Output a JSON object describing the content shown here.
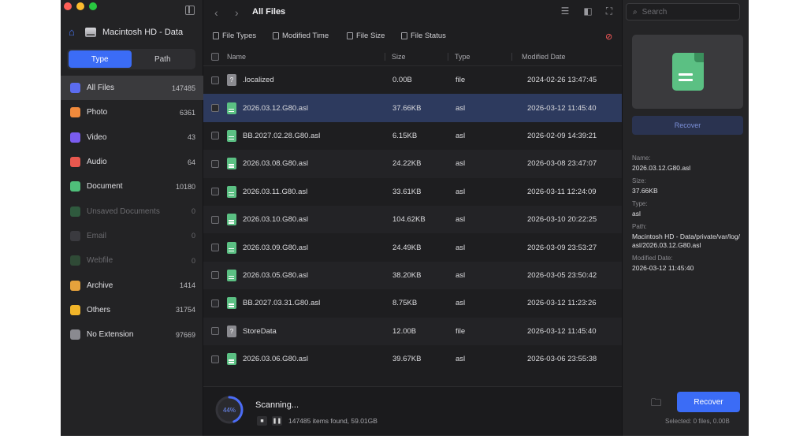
{
  "window": {
    "title": "All Files"
  },
  "sidebar": {
    "drive": "Macintosh HD - Data",
    "view_modes": [
      "Type",
      "Path"
    ],
    "categories": [
      {
        "label": "All Files",
        "count": "147485",
        "color": "#5b6cf0",
        "dim": false,
        "selected": true
      },
      {
        "label": "Photo",
        "count": "6361",
        "color": "#f08a3c",
        "dim": false
      },
      {
        "label": "Video",
        "count": "43",
        "color": "#7a5cf0",
        "dim": false
      },
      {
        "label": "Audio",
        "count": "64",
        "color": "#e8584f",
        "dim": false
      },
      {
        "label": "Document",
        "count": "10180",
        "color": "#4fbf7a",
        "dim": false
      },
      {
        "label": "Unsaved Documents",
        "count": "0",
        "color": "#2f5a3e",
        "dim": true
      },
      {
        "label": "Email",
        "count": "0",
        "color": "#3a3a3f",
        "dim": true
      },
      {
        "label": "Webfile",
        "count": "0",
        "color": "#2f4a36",
        "dim": true
      },
      {
        "label": "Archive",
        "count": "1414",
        "color": "#e6a23c",
        "dim": false
      },
      {
        "label": "Others",
        "count": "31754",
        "color": "#f0b429",
        "dim": false
      },
      {
        "label": "No Extension",
        "count": "97669",
        "color": "#8a8a90",
        "dim": false
      }
    ]
  },
  "filters": [
    "File Types",
    "Modified Time",
    "File Size",
    "File Status"
  ],
  "table": {
    "headers": {
      "name": "Name",
      "size": "Size",
      "type": "Type",
      "date": "Modified Date"
    },
    "rows": [
      {
        "icon": "unknown-file-icon",
        "name": ".localized",
        "size": "0.00B",
        "type": "file",
        "date": "2024-02-26 13:47:45"
      },
      {
        "icon": "document-icon",
        "name": "2026.03.12.G80.asl",
        "size": "37.66KB",
        "type": "asl",
        "date": "2026-03-12 11:45:40",
        "selected": true
      },
      {
        "icon": "document-icon",
        "name": "BB.2027.02.28.G80.asl",
        "size": "6.15KB",
        "type": "asl",
        "date": "2026-02-09 14:39:21"
      },
      {
        "icon": "document-icon",
        "name": "2026.03.08.G80.asl",
        "size": "24.22KB",
        "type": "asl",
        "date": "2026-03-08 23:47:07"
      },
      {
        "icon": "document-icon",
        "name": "2026.03.11.G80.asl",
        "size": "33.61KB",
        "type": "asl",
        "date": "2026-03-11 12:24:09"
      },
      {
        "icon": "document-icon",
        "name": "2026.03.10.G80.asl",
        "size": "104.62KB",
        "type": "asl",
        "date": "2026-03-10 20:22:25"
      },
      {
        "icon": "document-icon",
        "name": "2026.03.09.G80.asl",
        "size": "24.49KB",
        "type": "asl",
        "date": "2026-03-09 23:53:27"
      },
      {
        "icon": "document-icon",
        "name": "2026.03.05.G80.asl",
        "size": "38.20KB",
        "type": "asl",
        "date": "2026-03-05 23:50:42"
      },
      {
        "icon": "document-icon",
        "name": "BB.2027.03.31.G80.asl",
        "size": "8.75KB",
        "type": "asl",
        "date": "2026-03-12 11:23:26"
      },
      {
        "icon": "unknown-file-icon",
        "name": "StoreData",
        "size": "12.00B",
        "type": "file",
        "date": "2026-03-12 11:45:40"
      },
      {
        "icon": "document-icon",
        "name": "2026.03.06.G80.asl",
        "size": "39.67KB",
        "type": "asl",
        "date": "2026-03-06 23:55:38"
      }
    ]
  },
  "scan": {
    "percent_label": "44%",
    "progress": 0.44,
    "title": "Scanning...",
    "status": "147485 items found, 59.01GB"
  },
  "search": {
    "placeholder": "Search"
  },
  "preview": {
    "recover_label": "Recover",
    "name_label": "Name:",
    "name": "2026.03.12.G80.asl",
    "size_label": "Size:",
    "size": "37.66KB",
    "type_label": "Type:",
    "type": "asl",
    "path_label": "Path:",
    "path": "Macintosh HD - Data/private/var/log/asl/2026.03.12.G80.asl",
    "date_label": "Modified Date:",
    "date": "2026-03-12 11:45:40"
  },
  "bottom": {
    "recover_label": "Recover",
    "selected_info": "Selected: 0 files, 0.00B"
  },
  "colors": {
    "accent": "#3b6cf6",
    "selected_row": "#2d3a5e",
    "doc_green": "#5bc083"
  }
}
